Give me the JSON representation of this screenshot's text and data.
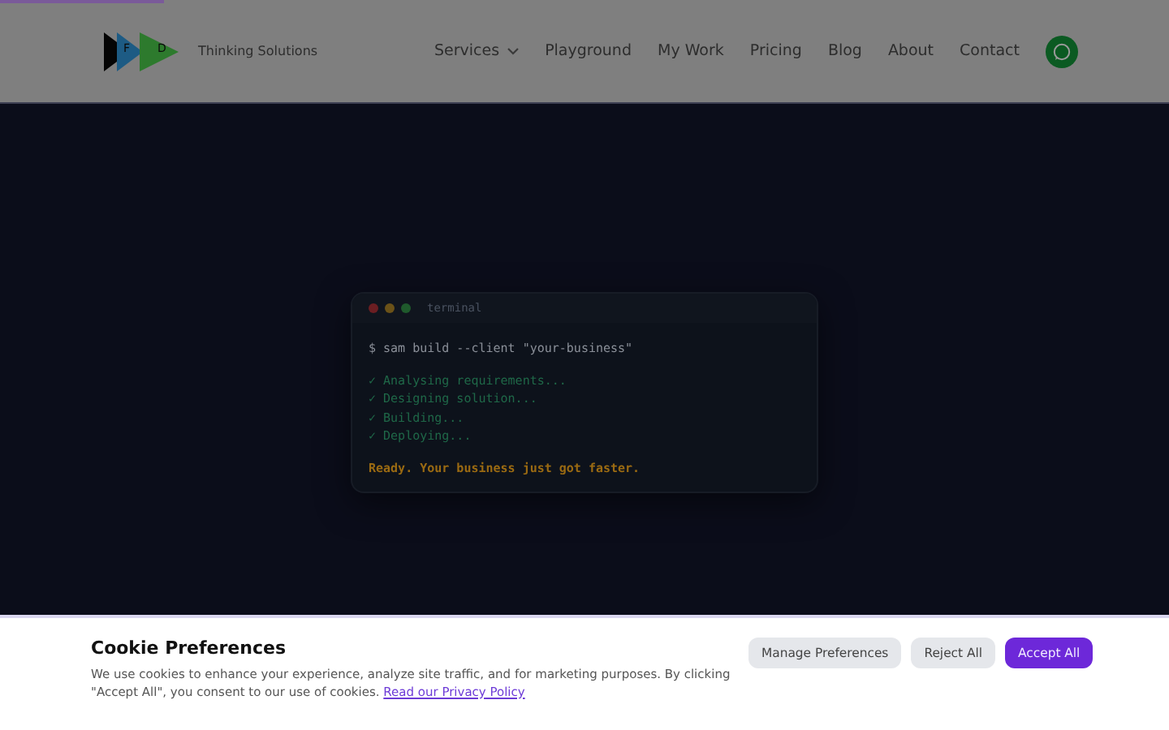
{
  "progress": {
    "level": 0.14
  },
  "header": {
    "logo_letters": [
      "F",
      "D"
    ],
    "tagline": "Thinking Solutions",
    "nav": [
      {
        "label": "Services",
        "dropdown": true
      },
      {
        "label": "Playground",
        "dropdown": false
      },
      {
        "label": "My Work",
        "dropdown": false
      },
      {
        "label": "Pricing",
        "dropdown": false
      },
      {
        "label": "Blog",
        "dropdown": false
      },
      {
        "label": "About",
        "dropdown": false
      },
      {
        "label": "Contact",
        "dropdown": false
      }
    ]
  },
  "terminal": {
    "title": "terminal",
    "lines": [
      {
        "kind": "command",
        "text": "$ sam build --client \"your-business\""
      },
      {
        "kind": "success",
        "text": "✓ Analysing requirements..."
      },
      {
        "kind": "success",
        "text": "✓ Designing solution..."
      },
      {
        "kind": "success",
        "text": "✓ Building..."
      },
      {
        "kind": "success",
        "text": "✓ Deploying..."
      },
      {
        "kind": "ready",
        "text": "Ready. Your business just got faster."
      }
    ]
  },
  "cookie_banner": {
    "title": "Cookie Preferences",
    "text": "We use cookies to enhance your experience, analyze site traffic, and for marketing purposes. By clicking \"Accept All\", you consent to our use of cookies.",
    "link": "Read our Privacy Policy",
    "buttons": [
      {
        "label": "Manage Preferences",
        "primary": false
      },
      {
        "label": "Reject All",
        "primary": false
      },
      {
        "label": "Accept All",
        "primary": true
      }
    ]
  }
}
